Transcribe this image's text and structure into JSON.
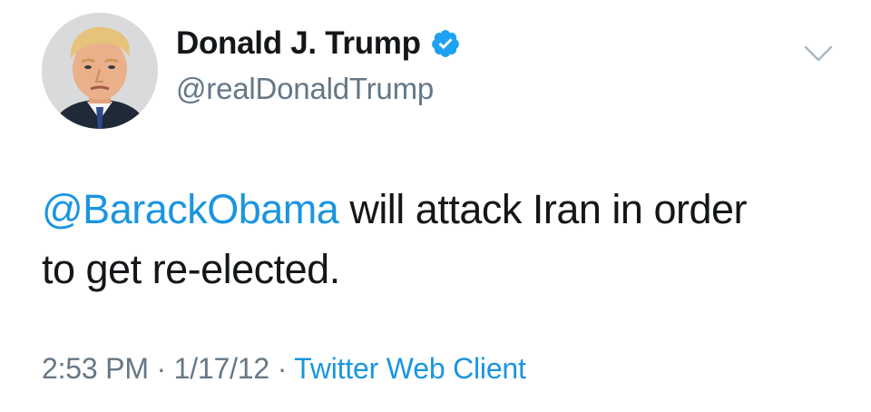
{
  "tweet": {
    "author": {
      "display_name": "Donald J. Trump",
      "handle": "@realDonaldTrump",
      "verified": true,
      "avatar_icon": "profile-photo"
    },
    "menu_icon": "chevron-down-icon",
    "text": {
      "mention": "@BarackObama",
      "body_line1": " will attack Iran in order",
      "body_line2": "to get re-elected."
    },
    "meta": {
      "time": "2:53 PM",
      "separator1": " · ",
      "date": "1/17/12",
      "separator2": " · ",
      "source": "Twitter Web Client"
    },
    "colors": {
      "link_blue": "#1b95e0",
      "secondary_gray": "#657786",
      "primary_text": "#14171a",
      "verified_blue": "#1da1f2"
    }
  }
}
